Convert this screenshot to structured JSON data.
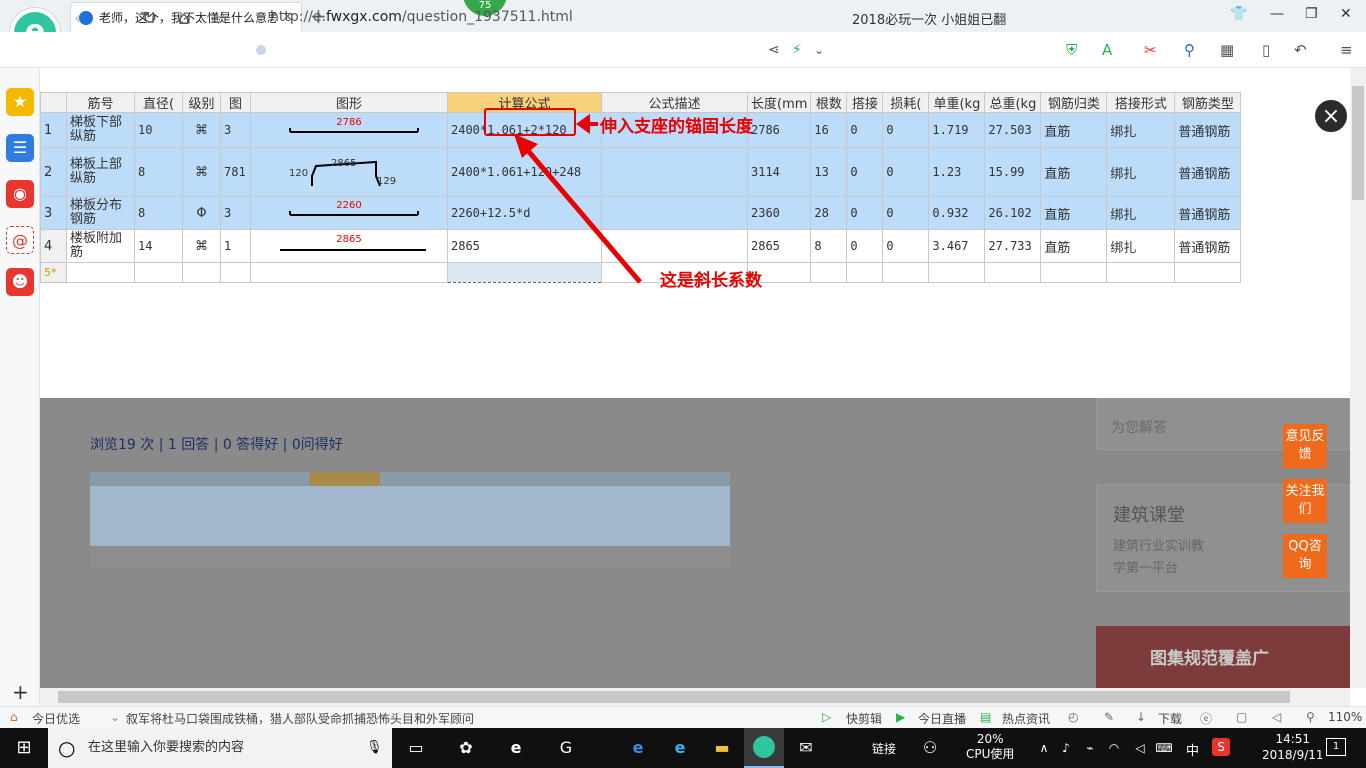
{
  "browser": {
    "tab_title": "老师，这个，我不太懂是什么意思",
    "new_tab": "+",
    "badge": "75",
    "url_prefix": "http://e.",
    "url_domain": "fwxgx.com",
    "url_path": "/question_1937511.html",
    "news_ticker": "2018必玩一次 小姐姐已翻"
  },
  "sidebar": {
    "add": "+"
  },
  "overlay": {
    "close": "×"
  },
  "table": {
    "headers": [
      "筋号",
      "直径(",
      "级别",
      "图",
      "图形",
      "计算公式",
      "公式描述",
      "长度(mm",
      "根数",
      "搭接",
      "损耗(",
      "单重(kg",
      "总重(kg",
      "钢筋归类",
      "搭接形式",
      "钢筋类型"
    ],
    "rows": [
      {
        "n": "1",
        "name": "梯板下部纵筋",
        "dia": "10",
        "grade": "⌘",
        "fig": "3",
        "shape_label": "2786",
        "formula": "2400*1.061+2*120",
        "desc": "",
        "length": "2786",
        "count": "16",
        "lap": "0",
        "loss": "0",
        "unit": "1.719",
        "total": "27.503",
        "cls": "直筋",
        "lapform": "绑扎",
        "type": "普通钢筋"
      },
      {
        "n": "2",
        "name": "梯板上部纵筋",
        "dia": "8",
        "grade": "⌘",
        "fig": "781",
        "shape_label": "2865",
        "shape_left": "120",
        "shape_right": "129",
        "formula": "2400*1.061+120+248",
        "desc": "",
        "length": "3114",
        "count": "13",
        "lap": "0",
        "loss": "0",
        "unit": "1.23",
        "total": "15.99",
        "cls": "直筋",
        "lapform": "绑扎",
        "type": "普通钢筋"
      },
      {
        "n": "3",
        "name": "梯板分布钢筋",
        "dia": "8",
        "grade": "Φ",
        "fig": "3",
        "shape_label": "2260",
        "formula": "2260+12.5*d",
        "desc": "",
        "length": "2360",
        "count": "28",
        "lap": "0",
        "loss": "0",
        "unit": "0.932",
        "total": "26.102",
        "cls": "直筋",
        "lapform": "绑扎",
        "type": "普通钢筋"
      },
      {
        "n": "4",
        "name": "楼板附加筋",
        "dia": "14",
        "grade": "⌘",
        "fig": "1",
        "shape_label": "2865",
        "formula": "2865",
        "desc": "",
        "length": "2865",
        "count": "8",
        "lap": "0",
        "loss": "0",
        "unit": "3.467",
        "total": "27.733",
        "cls": "直筋",
        "lapform": "绑扎",
        "type": "普通钢筋"
      }
    ],
    "new_row": "5*"
  },
  "annotations": {
    "anchor": "伸入支座的锚固长度",
    "slope": "这是斜长系数"
  },
  "page_behind": {
    "stats": "浏览19 次 | 1 回答 | 0 答得好 | 0问得好",
    "side_tip": "为您解答",
    "course_title": "建筑课堂",
    "course_sub1": "建筑行业实训教",
    "course_sub2": "学第一平台",
    "banner": "图集规范覆盖广",
    "feedback": [
      "意见反馈",
      "关注我们",
      "QQ咨询"
    ]
  },
  "statusbar": {
    "today": "今日优选",
    "headline": "叙军将杜马口袋围成铁桶，猎人部队受命抓捕恐怖头目和外军顾问",
    "quick": "快剪辑",
    "live": "今日直播",
    "hot": "热点资讯",
    "download": "下载",
    "zoom": "110%"
  },
  "taskbar": {
    "search_placeholder": "在这里输入你要搜索的内容",
    "link": "链接",
    "cpu_pct": "20%",
    "cpu_label": "CPU使用",
    "ime": "中",
    "time": "14:51",
    "date": "2018/9/11",
    "notif": "1"
  },
  "colors": {
    "selection": "#bcdcfa",
    "header_highlight": "#f7d07a",
    "annotation": "#e80000",
    "accent": "#ef6a1a"
  }
}
